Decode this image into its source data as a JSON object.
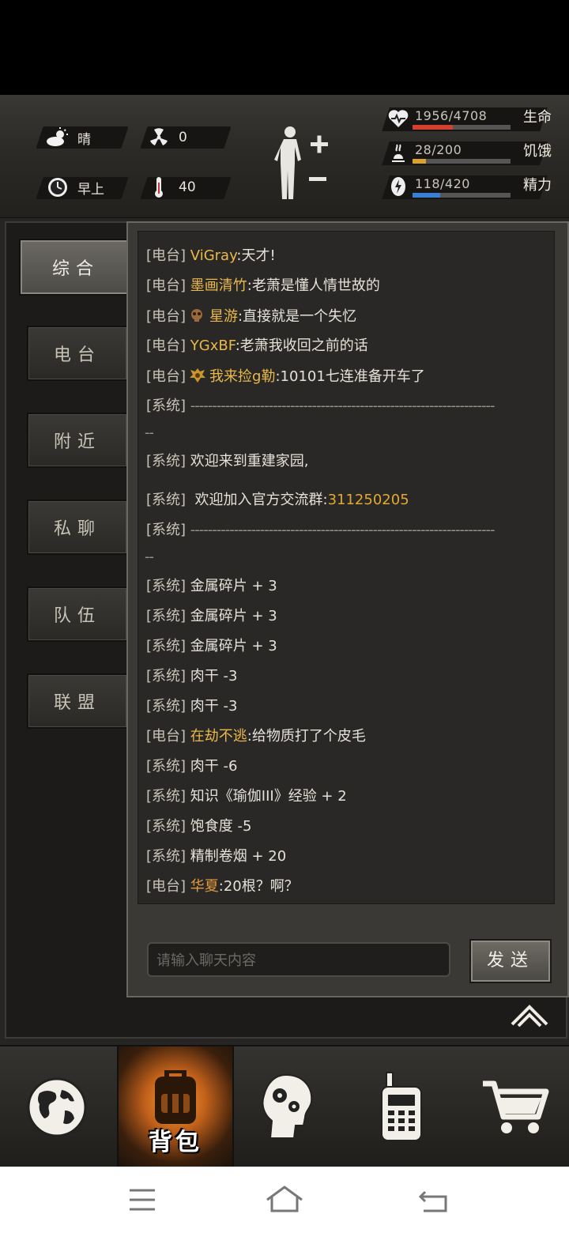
{
  "hud": {
    "weather": {
      "icon": "sun-cloud-icon",
      "label": "晴"
    },
    "radiation": {
      "icon": "radiation-icon",
      "value": "0"
    },
    "time": {
      "icon": "clock-icon",
      "label": "早上"
    },
    "temperature": {
      "icon": "thermometer-icon",
      "value": "40"
    },
    "stats": [
      {
        "name": "生命",
        "icon": "heart-icon",
        "value": "1956/4708",
        "fraction": 0.415,
        "color": "#d3402f"
      },
      {
        "name": "饥饿",
        "icon": "hunger-icon",
        "value": "28/200",
        "fraction": 0.14,
        "color": "#d8a22c"
      },
      {
        "name": "精力",
        "icon": "energy-icon",
        "value": "118/420",
        "fraction": 0.28,
        "color": "#3b7fd4"
      }
    ]
  },
  "tabs": [
    {
      "label": "综合",
      "active": true
    },
    {
      "label": "电台",
      "active": false
    },
    {
      "label": "附近",
      "active": false
    },
    {
      "label": "私聊",
      "active": false
    },
    {
      "label": "队伍",
      "active": false
    },
    {
      "label": "联盟",
      "active": false
    }
  ],
  "messages": [
    {
      "tag": "[电台]",
      "name": "ViGray",
      "text": ":天才!"
    },
    {
      "tag": "[电台]",
      "name": "墨画清竹",
      "text": ":老萧是懂人情世故的"
    },
    {
      "tag": "[电台]",
      "name": "星游",
      "text": ":直接就是一个失忆"
    },
    {
      "tag": "[电台]",
      "name": "YGxBF",
      "text": ":老萧我收回之前的话"
    },
    {
      "tag": "[电台]",
      "name": "我来捡g勒",
      "text": ":10101七连准备开车了"
    },
    {
      "tag": "[系统]",
      "text": "----------------------------------------------------------------------"
    },
    {
      "tag": "[系统]",
      "text": "欢迎来到重建家园,"
    },
    {
      "tag": "[系统]",
      "text": "欢迎加入官方交流群:",
      "extra": "311250205"
    },
    {
      "tag": "[系统]",
      "text": "----------------------------------------------------------------------"
    },
    {
      "tag": "[系统]",
      "text": "金属碎片 + 3"
    },
    {
      "tag": "[系统]",
      "text": "金属碎片 + 3"
    },
    {
      "tag": "[系统]",
      "text": "金属碎片 + 3"
    },
    {
      "tag": "[系统]",
      "text": "肉干 -3"
    },
    {
      "tag": "[系统]",
      "text": "肉干 -3"
    },
    {
      "tag": "[电台]",
      "name": "在劫不逃",
      "text": ":给物质打了个皮毛"
    },
    {
      "tag": "[系统]",
      "text": "肉干 -6"
    },
    {
      "tag": "[系统]",
      "text": "知识《瑜伽III》经验 + 2"
    },
    {
      "tag": "[系统]",
      "text": "饱食度 -5"
    },
    {
      "tag": "[系统]",
      "text": "精制卷烟 + 20"
    },
    {
      "tag": "[电台]",
      "name": "华夏",
      "text": ":20根？啊？"
    }
  ],
  "input": {
    "placeholder": "请输入聊天内容"
  },
  "send_label": "发送",
  "nav": [
    {
      "icon": "globe-icon"
    },
    {
      "icon": "backpack-icon",
      "label": "背包",
      "active": true
    },
    {
      "icon": "head-gears-icon"
    },
    {
      "icon": "walkie-talkie-icon"
    },
    {
      "icon": "shopping-cart-icon"
    }
  ]
}
